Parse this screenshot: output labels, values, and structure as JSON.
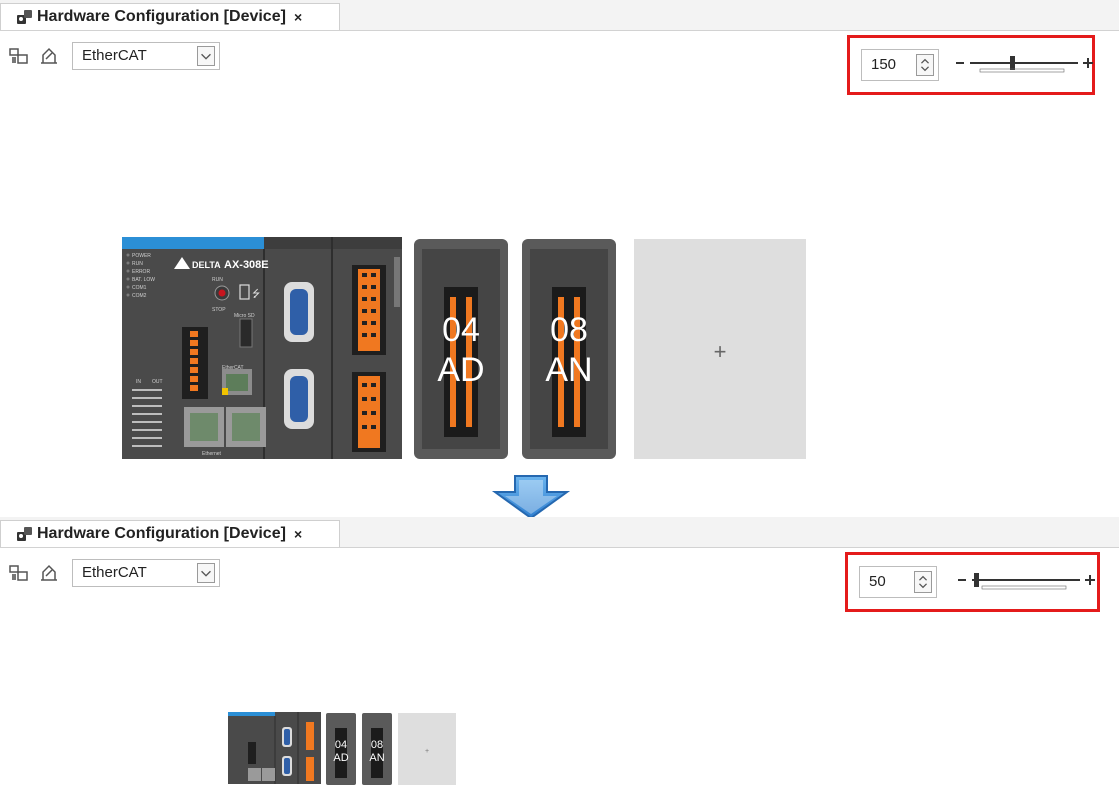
{
  "panels": [
    {
      "tab_title": "Hardware Configuration [Device]",
      "close_glyph": "×",
      "protocol": "EtherCAT",
      "zoom_value": "150",
      "zoom_level_fraction": 0.4
    },
    {
      "tab_title": "Hardware Configuration [Device]",
      "close_glyph": "×",
      "protocol": "EtherCAT",
      "zoom_value": "50",
      "zoom_level_fraction": 0.1
    }
  ],
  "cpu_module": {
    "brand": "DELTA",
    "model": "AX-308E",
    "leds": [
      "POWER",
      "RUN",
      "ERROR",
      "BAT. LOW",
      "COM1",
      "COM2"
    ],
    "labels": {
      "run": "RUN",
      "stop": "STOP",
      "microsd": "Micro SD",
      "ethercat": "EtherCAT",
      "ethernet": "Ethernet",
      "in": "IN",
      "out": "OUT"
    }
  },
  "io_modules": [
    {
      "line1": "04",
      "line2": "AD"
    },
    {
      "line1": "08",
      "line2": "AN"
    }
  ],
  "add_slot_symbol": "+",
  "colors": {
    "highlight": "#e41b1b",
    "delta_blue": "#2b8fd6",
    "terminal_orange": "#f07820",
    "arrow_blue": "#4a9de0"
  },
  "icons": [
    "hardware-tab-icon",
    "device-tree-icon",
    "scan-icon",
    "spin-updown-icon",
    "dropdown-arrow-icon",
    "arrow-down-icon"
  ]
}
